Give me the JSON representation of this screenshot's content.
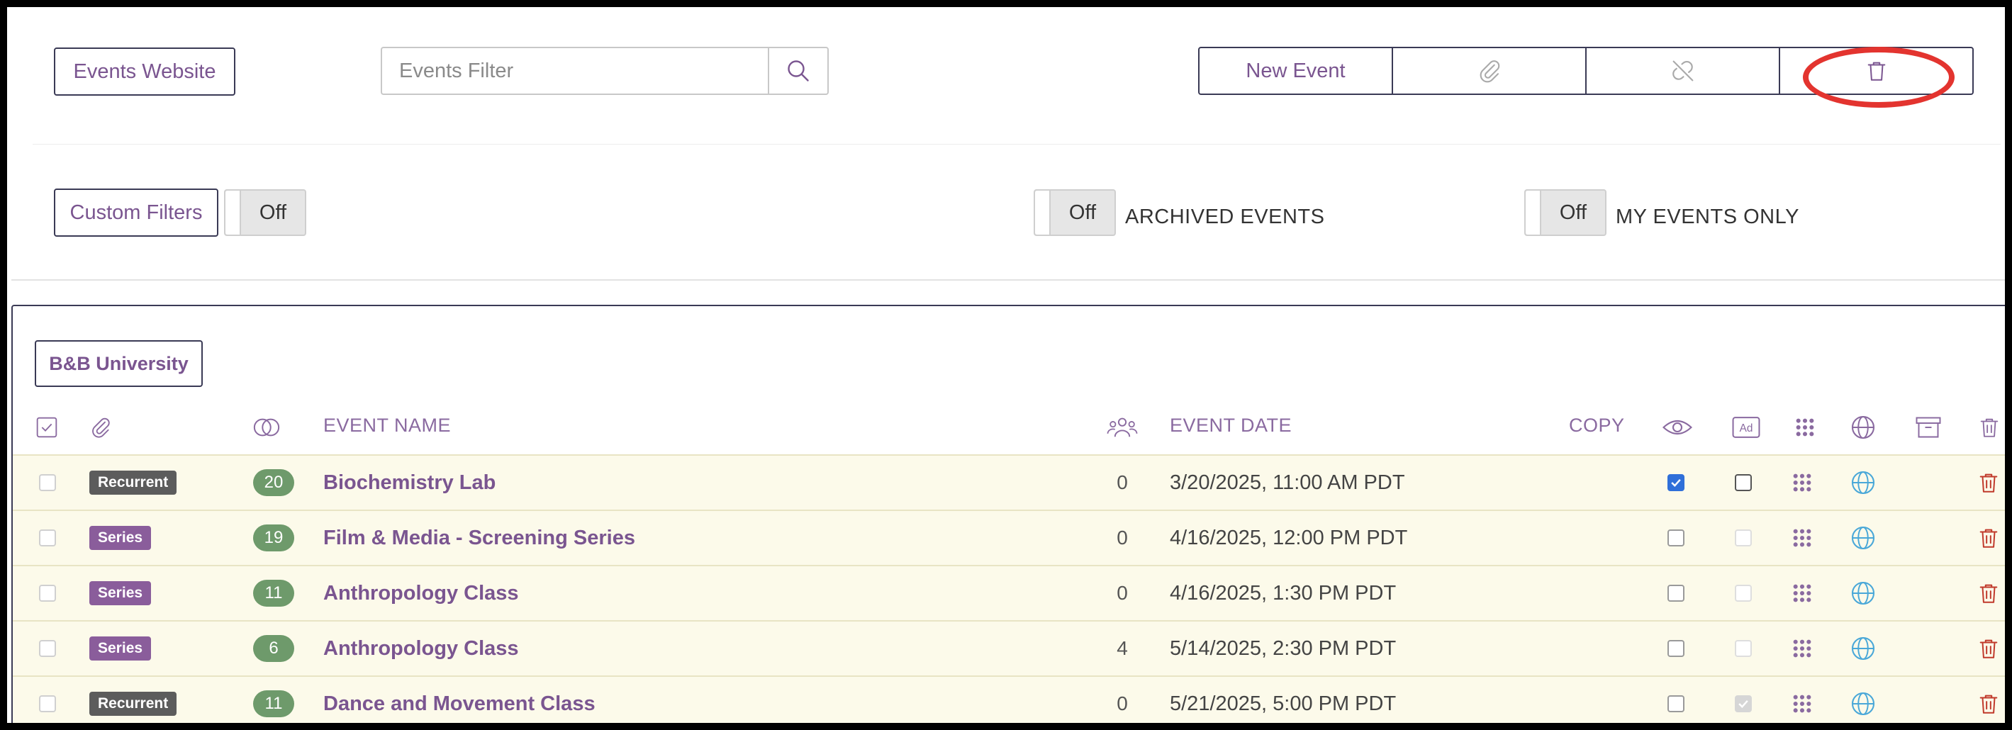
{
  "header": {
    "events_website_label": "Events Website",
    "filter_placeholder": "Events Filter",
    "new_event_label": "New Event",
    "custom_filters_label": "Custom Filters",
    "custom_filters_toggle": "Off",
    "archived_toggle": "Off",
    "archived_label": "ARCHIVED EVENTS",
    "my_events_toggle": "Off",
    "my_events_label": "MY EVENTS ONLY"
  },
  "group": {
    "name": "B&B University"
  },
  "columns": {
    "event_name": "EVENT NAME",
    "event_date": "EVENT DATE",
    "copy": "COPY"
  },
  "colors": {
    "accent": "#7a5590",
    "row_bg": "#fcfaea",
    "series_tag": "#8a5d9b",
    "recurrent_tag": "#5c5c5c",
    "count_pill": "#6e9a6b",
    "delete": "#c0392b",
    "globe": "#4aa8d8",
    "highlight_circle": "#e3342f"
  },
  "rows": [
    {
      "tag": "Recurrent",
      "tag_type": "recurrent",
      "count": "20",
      "name": "Biochemistry Lab",
      "attendees": "0",
      "date": "3/20/2025, 11:00 AM PDT",
      "visible": true,
      "ad": "empty"
    },
    {
      "tag": "Series",
      "tag_type": "series",
      "count": "19",
      "name": "Film & Media - Screening Series",
      "attendees": "0",
      "date": "4/16/2025, 12:00 PM PDT",
      "visible": false,
      "ad": "disabled"
    },
    {
      "tag": "Series",
      "tag_type": "series",
      "count": "11",
      "name": "Anthropology Class",
      "attendees": "0",
      "date": "4/16/2025, 1:30 PM PDT",
      "visible": false,
      "ad": "disabled"
    },
    {
      "tag": "Series",
      "tag_type": "series",
      "count": "6",
      "name": "Anthropology Class",
      "attendees": "4",
      "date": "5/14/2025, 2:30 PM PDT",
      "visible": false,
      "ad": "disabled"
    },
    {
      "tag": "Recurrent",
      "tag_type": "recurrent",
      "count": "11",
      "name": "Dance and Movement Class",
      "attendees": "0",
      "date": "5/21/2025, 5:00 PM PDT",
      "visible": false,
      "ad": "checked-disabled"
    }
  ]
}
